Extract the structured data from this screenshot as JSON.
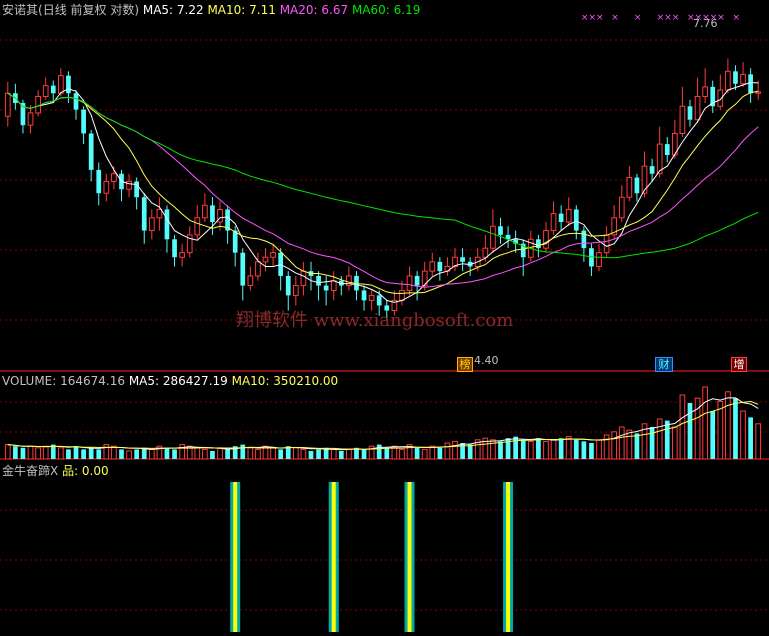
{
  "header": {
    "stock_name": "安诺其",
    "period_info": "(日线 前复权 对数)",
    "ma5": "MA5: 7.22",
    "ma10": "MA10: 7.11",
    "ma20": "MA20: 6.67",
    "ma60": "MA60: 6.19"
  },
  "volume_header": {
    "volume": "VOLUME: 164674.16",
    "ma5": "MA5: 286427.19",
    "ma10": "MA10: 350210.00"
  },
  "indicator_header": {
    "name": "金牛奋蹄X",
    "value": "品: 0.00"
  },
  "watermark": "翔博软件 www.xiangbosoft.com",
  "annotations": {
    "high_label": "7.76",
    "low_label": "4.40",
    "badge_bang": "榜",
    "badge_cai": "财",
    "badge_zeng": "增"
  },
  "colors": {
    "up": "#ff3c3c",
    "down": "#54fcfc",
    "ma5": "#ffffff",
    "ma10": "#ffff54",
    "ma20": "#ff54ff",
    "ma60": "#00e600",
    "grid": "#8b0000"
  },
  "chart_data": {
    "type": "candlestick",
    "scale": "log",
    "price_range": [
      4.0,
      8.4
    ],
    "candles": [
      [
        6.85,
        7.2,
        7.38,
        6.7
      ],
      [
        7.2,
        7.05,
        7.35,
        6.95
      ],
      [
        7.05,
        6.72,
        7.1,
        6.6
      ],
      [
        6.72,
        6.9,
        7.02,
        6.6
      ],
      [
        6.9,
        7.15,
        7.25,
        6.85
      ],
      [
        7.15,
        7.32,
        7.45,
        7.1
      ],
      [
        7.32,
        7.2,
        7.4,
        7.05
      ],
      [
        7.2,
        7.48,
        7.6,
        7.15
      ],
      [
        7.48,
        7.2,
        7.55,
        7.05
      ],
      [
        7.2,
        6.95,
        7.25,
        6.8
      ],
      [
        6.95,
        6.6,
        7.0,
        6.45
      ],
      [
        6.6,
        6.1,
        6.65,
        5.95
      ],
      [
        6.1,
        5.8,
        6.2,
        5.65
      ],
      [
        5.8,
        5.95,
        6.05,
        5.7
      ],
      [
        5.95,
        6.05,
        6.15,
        5.85
      ],
      [
        6.05,
        5.85,
        6.1,
        5.7
      ],
      [
        5.85,
        5.95,
        6.05,
        5.75
      ],
      [
        5.95,
        5.75,
        6.0,
        5.6
      ],
      [
        5.75,
        5.35,
        5.8,
        5.2
      ],
      [
        5.35,
        5.5,
        5.6,
        5.25
      ],
      [
        5.5,
        5.6,
        5.75,
        5.35
      ],
      [
        5.6,
        5.25,
        5.65,
        5.1
      ],
      [
        5.25,
        5.05,
        5.3,
        4.95
      ],
      [
        5.05,
        5.1,
        5.2,
        4.95
      ],
      [
        5.1,
        5.3,
        5.4,
        5.05
      ],
      [
        5.3,
        5.5,
        5.65,
        5.25
      ],
      [
        5.5,
        5.65,
        5.8,
        5.45
      ],
      [
        5.65,
        5.45,
        5.75,
        5.3
      ],
      [
        5.45,
        5.6,
        5.7,
        5.35
      ],
      [
        5.6,
        5.35,
        5.65,
        5.2
      ],
      [
        5.35,
        5.1,
        5.4,
        4.95
      ],
      [
        5.1,
        4.75,
        5.15,
        4.6
      ],
      [
        4.75,
        4.85,
        4.95,
        4.7
      ],
      [
        4.85,
        5.0,
        5.1,
        4.8
      ],
      [
        5.0,
        5.05,
        5.15,
        4.9
      ],
      [
        5.05,
        5.1,
        5.2,
        4.95
      ],
      [
        5.1,
        4.85,
        5.15,
        4.7
      ],
      [
        4.85,
        4.65,
        4.9,
        4.5
      ],
      [
        4.65,
        4.75,
        4.85,
        4.55
      ],
      [
        4.75,
        4.9,
        5.0,
        4.65
      ],
      [
        4.9,
        4.85,
        5.0,
        4.7
      ],
      [
        4.85,
        4.75,
        4.9,
        4.6
      ],
      [
        4.75,
        4.7,
        4.85,
        4.55
      ],
      [
        4.7,
        4.8,
        4.9,
        4.6
      ],
      [
        4.8,
        4.75,
        4.85,
        4.65
      ],
      [
        4.75,
        4.85,
        4.95,
        4.7
      ],
      [
        4.85,
        4.7,
        4.9,
        4.6
      ],
      [
        4.7,
        4.6,
        4.75,
        4.5
      ],
      [
        4.6,
        4.65,
        4.7,
        4.5
      ],
      [
        4.65,
        4.55,
        4.7,
        4.45
      ],
      [
        4.55,
        4.5,
        4.6,
        4.4
      ],
      [
        4.5,
        4.6,
        4.7,
        4.45
      ],
      [
        4.6,
        4.7,
        4.8,
        4.55
      ],
      [
        4.7,
        4.85,
        4.95,
        4.65
      ],
      [
        4.85,
        4.75,
        4.9,
        4.6
      ],
      [
        4.75,
        4.9,
        5.0,
        4.7
      ],
      [
        4.9,
        5.0,
        5.1,
        4.85
      ],
      [
        5.0,
        4.9,
        5.05,
        4.8
      ],
      [
        4.9,
        4.95,
        5.05,
        4.85
      ],
      [
        4.95,
        5.05,
        5.15,
        4.9
      ],
      [
        5.05,
        5.0,
        5.15,
        4.9
      ],
      [
        5.0,
        4.95,
        5.05,
        4.85
      ],
      [
        4.95,
        5.05,
        5.15,
        4.9
      ],
      [
        5.05,
        5.15,
        5.3,
        5.0
      ],
      [
        5.15,
        5.4,
        5.6,
        5.1
      ],
      [
        5.4,
        5.3,
        5.5,
        5.2
      ],
      [
        5.3,
        5.25,
        5.4,
        5.15
      ],
      [
        5.25,
        5.2,
        5.35,
        5.1
      ],
      [
        5.2,
        5.05,
        5.25,
        4.85
      ],
      [
        5.05,
        5.25,
        5.35,
        5.0
      ],
      [
        5.25,
        5.15,
        5.3,
        5.05
      ],
      [
        5.15,
        5.35,
        5.45,
        5.1
      ],
      [
        5.35,
        5.55,
        5.7,
        5.3
      ],
      [
        5.55,
        5.45,
        5.65,
        5.35
      ],
      [
        5.45,
        5.6,
        5.75,
        5.4
      ],
      [
        5.6,
        5.35,
        5.65,
        5.25
      ],
      [
        5.35,
        5.15,
        5.4,
        5.0
      ],
      [
        5.15,
        4.95,
        5.2,
        4.85
      ],
      [
        4.95,
        5.1,
        5.2,
        4.9
      ],
      [
        5.1,
        5.3,
        5.4,
        5.05
      ],
      [
        5.3,
        5.5,
        5.65,
        5.25
      ],
      [
        5.5,
        5.75,
        5.9,
        5.45
      ],
      [
        5.75,
        6.0,
        6.15,
        5.7
      ],
      [
        6.0,
        5.8,
        6.05,
        5.7
      ],
      [
        5.8,
        6.15,
        6.35,
        5.75
      ],
      [
        6.15,
        6.05,
        6.25,
        5.95
      ],
      [
        6.05,
        6.45,
        6.7,
        6.0
      ],
      [
        6.45,
        6.3,
        6.55,
        6.2
      ],
      [
        6.3,
        6.6,
        6.8,
        6.25
      ],
      [
        6.6,
        7.0,
        7.3,
        6.55
      ],
      [
        7.0,
        6.8,
        7.1,
        6.7
      ],
      [
        6.8,
        7.15,
        7.45,
        6.75
      ],
      [
        7.15,
        7.3,
        7.6,
        7.05
      ],
      [
        7.3,
        7.0,
        7.4,
        6.9
      ],
      [
        7.0,
        7.25,
        7.5,
        6.95
      ],
      [
        7.25,
        7.55,
        7.76,
        7.2
      ],
      [
        7.55,
        7.35,
        7.65,
        7.25
      ],
      [
        7.35,
        7.5,
        7.7,
        7.3
      ],
      [
        7.5,
        7.2,
        7.6,
        7.05
      ],
      [
        7.2,
        7.22,
        7.4,
        7.1
      ]
    ],
    "volume": [
      0.9,
      0.8,
      0.7,
      0.8,
      0.7,
      0.8,
      0.9,
      0.7,
      0.6,
      0.8,
      0.6,
      0.7,
      0.6,
      0.9,
      0.8,
      0.6,
      0.5,
      0.6,
      0.7,
      0.6,
      0.8,
      0.7,
      0.6,
      0.9,
      0.8,
      0.7,
      0.6,
      0.5,
      0.7,
      0.6,
      0.8,
      0.9,
      0.7,
      0.6,
      0.8,
      0.7,
      0.6,
      0.8,
      0.7,
      0.6,
      0.5,
      0.6,
      0.7,
      0.6,
      0.5,
      0.6,
      0.7,
      0.6,
      0.8,
      0.9,
      0.7,
      0.8,
      0.6,
      0.9,
      0.7,
      0.6,
      0.8,
      0.7,
      1.0,
      1.1,
      1.0,
      0.9,
      1.2,
      1.3,
      1.2,
      1.1,
      1.3,
      1.4,
      1.2,
      1.1,
      1.3,
      1.1,
      1.2,
      1.3,
      1.4,
      1.2,
      1.1,
      1.0,
      1.2,
      1.5,
      1.7,
      2.0,
      1.8,
      1.6,
      2.2,
      2.0,
      2.5,
      2.4,
      2.0,
      4.0,
      3.5,
      3.8,
      4.5,
      3.0,
      3.6,
      4.2,
      3.8,
      3.0,
      2.6,
      2.2
    ],
    "indicator_bars": [
      30,
      43,
      53,
      66
    ]
  }
}
